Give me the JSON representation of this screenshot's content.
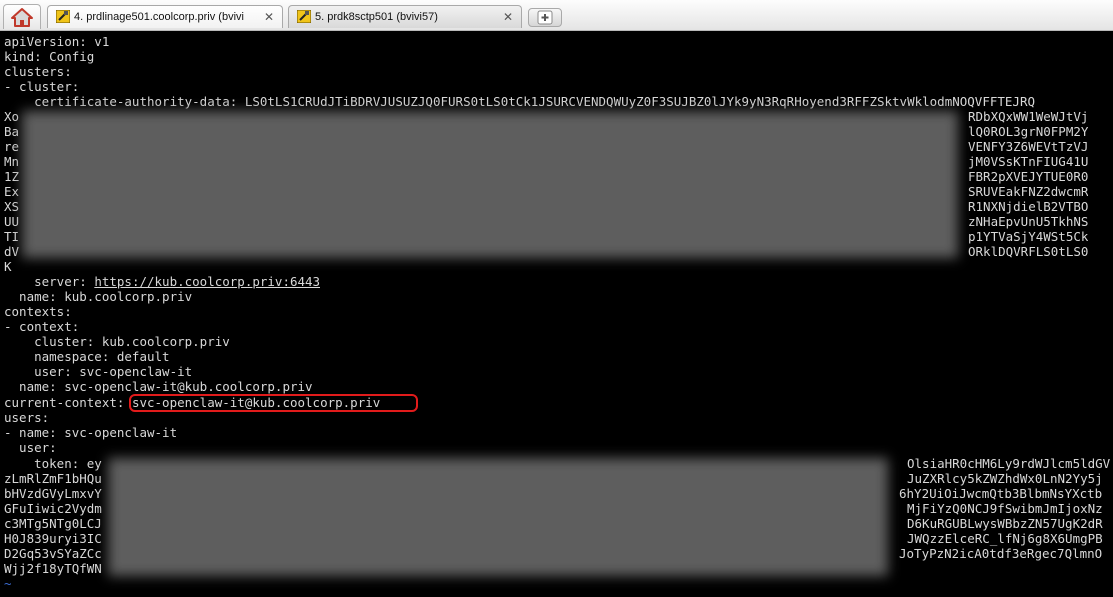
{
  "tabs": [
    {
      "label": "4. prdlinage501.coolcorp.priv (bvivi",
      "active": true
    },
    {
      "label": "5. prdk8sctp501 (bvivi57)",
      "active": false
    }
  ],
  "terminal": {
    "lines": {
      "l01": "apiVersion: v1",
      "l02": "kind: Config",
      "l03": "clusters:",
      "l04": "- cluster:",
      "l05": "    certificate-authority-data: LS0tLS1CRUdJTiBDRVJUSUZJQ0FURS0tLS0tCk1JSURCVENDQWUyZ0F3SUJBZ0lJYk9yN3RqRHoyend3RFFZSktvWklodmNOQVFFTEJRQ",
      "l06a": "Xo",
      "l06b": "RDbXQxWW1WeWJtVj",
      "l07a": "Ba",
      "l07b": "lQ0ROL3grN0FPM2Y",
      "l08a": "re",
      "l08b": "VENFY3Z6WEVtTzVJ",
      "l09a": "Mn",
      "l09b": "jM0VSsKTnFIUG41U",
      "l10a": "1Z",
      "l10b": "FBR2pXVEJYTUE0R0",
      "l11a": "Ex",
      "l11b": "SRUVEakFNZ2dwcmR",
      "l12a": "XS",
      "l12b": "R1NXNjdielB2VTBO",
      "l13a": "UU",
      "l13b": "zNHaEpvUnU5TkhNS",
      "l14a": "TI",
      "l14b": "p1YTVaSjY4WSt5Ck",
      "l15a": "dV",
      "l15b": "ORklDQVRFLS0tLS0",
      "l16": "K",
      "l17_prefix": "    server: ",
      "l17_link": "https://kub.coolcorp.priv:6443",
      "l18": "  name: kub.coolcorp.priv",
      "l19": "contexts:",
      "l20": "- context:",
      "l21": "    cluster: kub.coolcorp.priv",
      "l22": "    namespace: default",
      "l23": "    user: svc-openclaw-it",
      "l24": "  name: svc-openclaw-it@kub.coolcorp.priv",
      "l25_prefix": "current-context: ",
      "l25_value": "svc-openclaw-it@kub.coolcorp.priv",
      "l26": "users:",
      "l27": "- name: svc-openclaw-it",
      "l28": "  user:",
      "l29a": "    token: ey",
      "l29b": "OlsiaHR0cHM6Ly9rdWJlcm5ldGV",
      "l30a": "zLmRlZmF1bHQu",
      "l30b": "JuZXRlcy5kZWZhdWx0LnN2Yy5j",
      "l31a": "bHVzdGVyLmxvY",
      "l31b": "6hY2UiOiJwcmQtb3BlbmNsYXctb",
      "l32a": "GFuIiwic2Vydm",
      "l32b": "MjFiYzQ0NCJ9fSwibmJmIjoxNz",
      "l33a": "c3MTg5NTg0LCJ",
      "l33b": "D6KuRGUBLwysWBbzZN57UgK2dR",
      "l34a": "H0J839uryi3IC",
      "l34b": "JWQzzElceRC_lfNj6g8X6UmgPB",
      "l35a": "D2Gq53vSYaZCc",
      "l35b": "JoTyPzN2icA0tdf3eRgec7QlmnO",
      "l36a": "Wjj2f18yTQfWN",
      "l37": "~"
    }
  },
  "colors": {
    "terminal_bg": "#000000",
    "terminal_fg": "#d8d8d8",
    "highlight": "#e21b1b",
    "tilde": "#3a6bd0"
  },
  "icons": [
    "home-icon",
    "putty-icon",
    "close-icon",
    "new-tab-plus-icon"
  ]
}
